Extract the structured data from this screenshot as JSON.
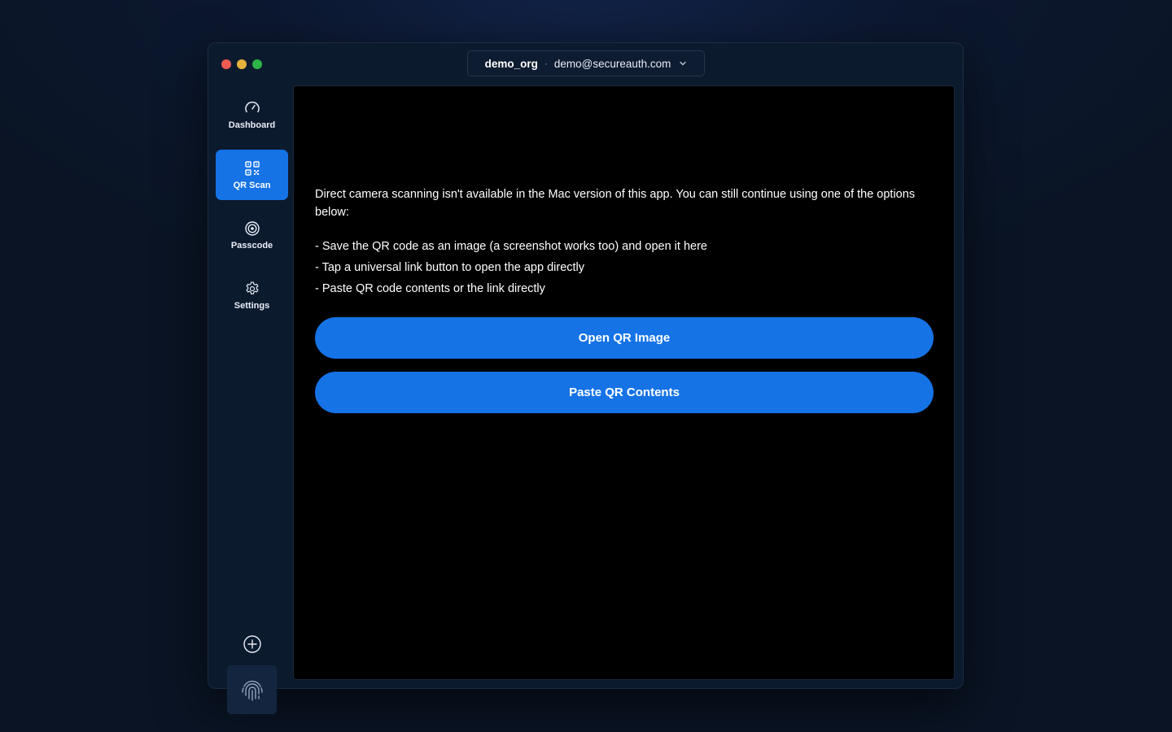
{
  "window": {
    "controls": [
      "close",
      "minimize",
      "zoom"
    ]
  },
  "account": {
    "org": "demo_org",
    "separator": "·",
    "email": "demo@secureauth.com"
  },
  "sidebar": {
    "items": [
      {
        "label": "Dashboard",
        "icon": "speedometer-icon",
        "active": false
      },
      {
        "label": "QR Scan",
        "icon": "qr-code-icon",
        "active": true
      },
      {
        "label": "Passcode",
        "icon": "target-icon",
        "active": false
      },
      {
        "label": "Settings",
        "icon": "gear-icon",
        "active": false
      }
    ],
    "add_icon": "plus-circle-icon",
    "biometric_icon": "fingerprint-icon"
  },
  "main": {
    "message": "Direct camera scanning isn't available in the Mac version of this app. You can still continue using one of the options below:",
    "options": [
      "- Save the QR code as an image (a screenshot works too) and open it here",
      "- Tap a universal link button to open the app directly",
      "- Paste QR code contents or the link directly"
    ],
    "open_button": "Open QR Image",
    "paste_button": "Paste QR Contents"
  },
  "colors": {
    "accent": "#1573e6",
    "window_bg": "#0c1a2e",
    "content_bg": "#000000",
    "traffic_red": "#ed5b52",
    "traffic_yellow": "#e5b23c",
    "traffic_green": "#2fb548"
  }
}
